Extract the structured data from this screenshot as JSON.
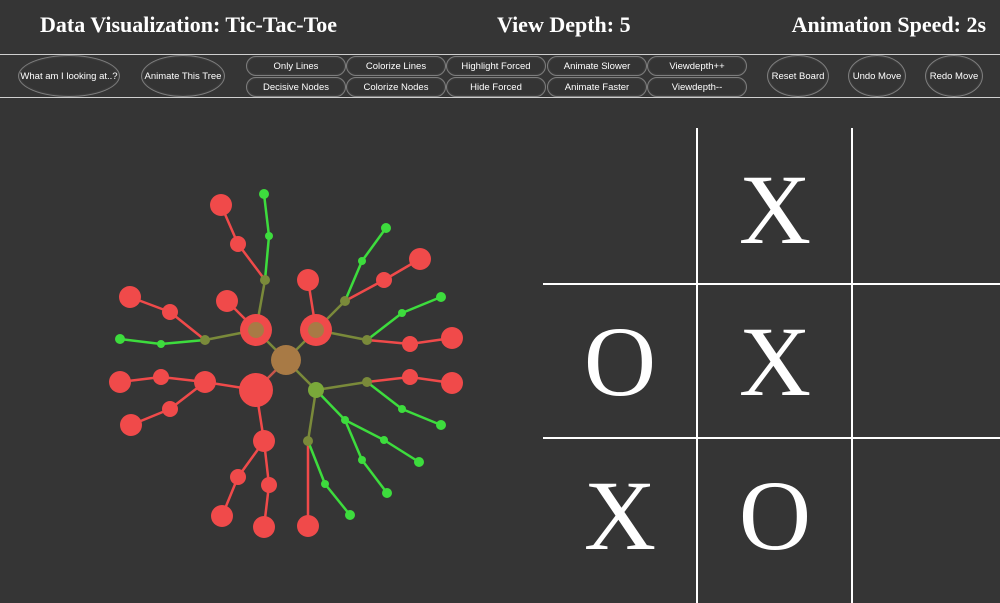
{
  "header": {
    "title": "Data Visualization: Tic-Tac-Toe",
    "view_depth": "View Depth: 5",
    "animation_speed": "Animation Speed: 2s"
  },
  "toolbar": {
    "what_label": "What am I looking at..?",
    "animate_tree_label": "Animate This Tree",
    "only_lines_label": "Only Lines",
    "decisive_nodes_label": "Decisive Nodes",
    "colorize_lines_label": "Colorize Lines",
    "colorize_nodes_label": "Colorize Nodes",
    "highlight_forced_label": "Highlight Forced",
    "hide_forced_label": "Hide Forced",
    "animate_slower_label": "Animate Slower",
    "animate_faster_label": "Animate Faster",
    "viewdepth_up_label": "Viewdepth++",
    "viewdepth_down_label": "Viewdepth--",
    "reset_board_label": "Reset Board",
    "undo_move_label": "Undo Move",
    "redo_move_label": "Redo Move"
  },
  "board": {
    "cells": [
      "",
      "X",
      "",
      "O",
      "X",
      "",
      "X",
      "O",
      ""
    ]
  },
  "colors": {
    "background": "#353535",
    "loss_red": "#f04a4a",
    "win_green": "#3ddc3d",
    "mixed_olive": "#7a8a3a",
    "root_brown": "#a87a45"
  }
}
